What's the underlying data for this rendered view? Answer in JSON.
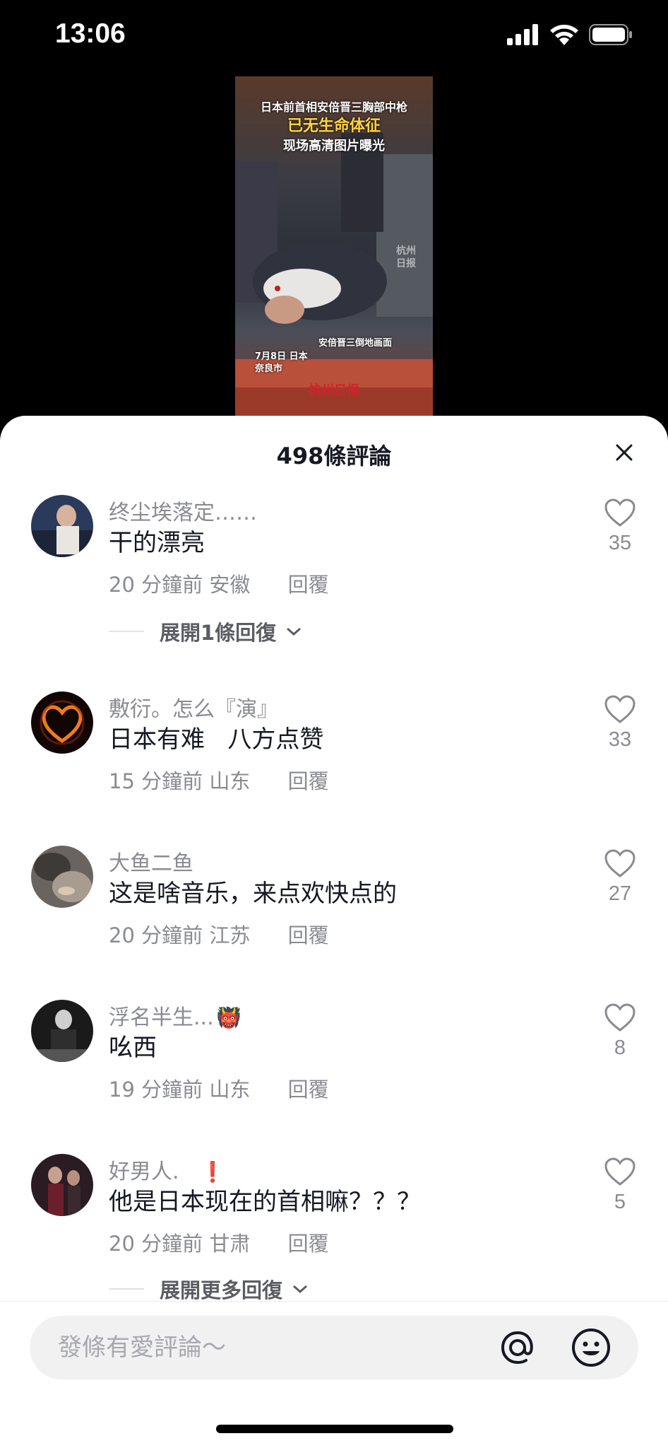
{
  "status_bar": {
    "time": "13:06"
  },
  "video": {
    "headline_1": "日本前首相安倍晋三胸部中枪",
    "headline_2": "已无生命体征",
    "headline_3": "现场高清图片曝光",
    "caption": "安倍晋三倒地画面",
    "date_place": "7月8日 日本 奈良市",
    "watermark": "杭州 日报",
    "logo": "杭州日报"
  },
  "sheet": {
    "title": "498條評論",
    "reply_label": "回覆",
    "comments": [
      {
        "name": "终尘埃落定……",
        "text": "干的漂亮",
        "time": "20 分鐘前",
        "location": "安徽",
        "likes": "35",
        "expand": "展開1條回復"
      },
      {
        "name": "敷衍。怎么『演』",
        "text": "日本有难   八方点赞",
        "time": "15 分鐘前",
        "location": "山东",
        "likes": "33"
      },
      {
        "name": "大鱼二鱼",
        "text": "这是啥音乐，来点欢快点的",
        "time": "20 分鐘前",
        "location": "江苏",
        "likes": "27"
      },
      {
        "name": "浮名半生...",
        "name_emoji": "👹",
        "text": "吆西",
        "time": "19 分鐘前",
        "location": "山东",
        "likes": "8"
      },
      {
        "name": "好男人.",
        "name_emoji": "❗",
        "text": "他是日本现在的首相嘛？？？",
        "time": "20 分鐘前",
        "location": "甘肃",
        "likes": "5",
        "expand": "展開更多回復"
      }
    ]
  },
  "input": {
    "placeholder": "發條有愛評論～"
  },
  "icons": {
    "signal": "signal-icon",
    "wifi": "wifi-icon",
    "battery": "battery-icon",
    "close": "close-icon",
    "heart": "heart-icon",
    "at": "at-icon",
    "emoji": "emoji-icon",
    "chevron": "chevron-down-icon"
  },
  "colors": {
    "text_primary": "#161823",
    "text_secondary": "#8a8b91",
    "sheet_bg": "#ffffff",
    "input_bg": "#f1f1f2"
  }
}
